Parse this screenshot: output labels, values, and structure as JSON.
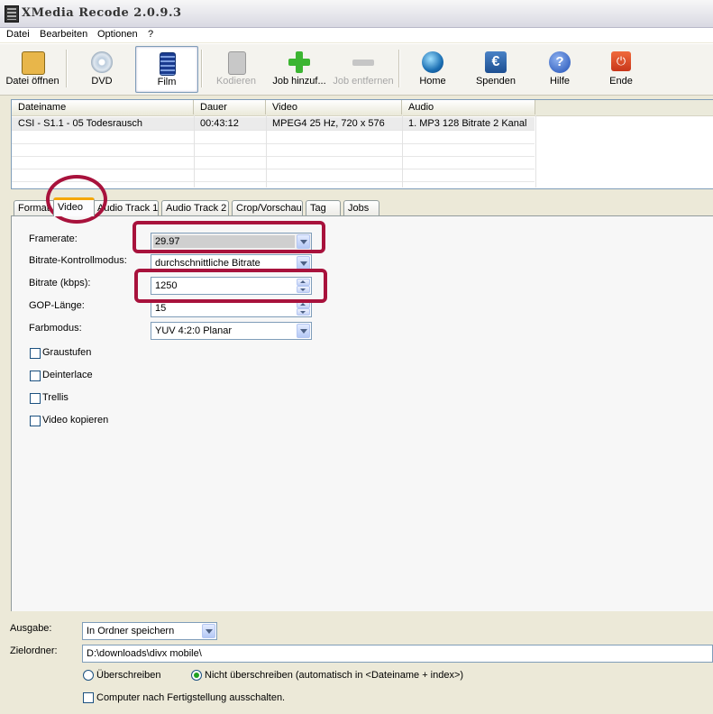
{
  "window": {
    "title": "XMedia Recode 2.0.9.3"
  },
  "menu": [
    "Datei",
    "Bearbeiten",
    "Optionen",
    "?"
  ],
  "toolbar": {
    "buttons": [
      {
        "label": "Datei öffnen"
      },
      {
        "label": "DVD"
      },
      {
        "label": "Film"
      },
      {
        "label": "Kodieren"
      },
      {
        "label": "Job hinzuf..."
      },
      {
        "label": "Job entfernen"
      },
      {
        "label": "Home"
      },
      {
        "label": "Spenden"
      },
      {
        "label": "Hilfe"
      },
      {
        "label": "Ende"
      }
    ]
  },
  "joblist": {
    "columns": [
      "Dateiname",
      "Dauer",
      "Video",
      "Audio"
    ],
    "rows": [
      [
        "CSI - S1.1 - 05 Todesrausch",
        "00:43:12",
        "MPEG4 25 Hz, 720 x 576",
        "1. MP3 128 Bitrate 2 Kanal"
      ]
    ]
  },
  "tabs": [
    "Format",
    "Video",
    "Audio Track 1",
    "Audio Track 2",
    "Crop/Vorschau",
    "Tag",
    "Jobs"
  ],
  "video": {
    "framerate_label": "Framerate:",
    "framerate_value": "29.97",
    "bitratemode_label": "Bitrate-Kontrollmodus:",
    "bitratemode_value": "durchschnittliche Bitrate",
    "bitrate_label": "Bitrate (kbps):",
    "bitrate_value": "1250",
    "gop_label": "GOP-Länge:",
    "gop_value": "15",
    "color_label": "Farbmodus:",
    "color_value": "YUV 4:2:0 Planar",
    "checkboxes": [
      "Graustufen",
      "Deinterlace",
      "Trellis",
      "Video kopieren"
    ]
  },
  "output": {
    "ausgabe_label": "Ausgabe:",
    "ausgabe_value": "In Ordner speichern",
    "zielordner_label": "Zielordner:",
    "zielordner_value": "D:\\downloads\\divx mobile\\",
    "radio_overwrite": "Überschreiben",
    "radio_nooverwrite": "Nicht überschreiben (automatisch in <Dateiname + index>)",
    "shutdown_label": "Computer nach Fertigstellung ausschalten."
  },
  "colors": {
    "marker": "#a8123c",
    "tab_accent": "#f5a700",
    "selection_row": "#ebebeb"
  }
}
